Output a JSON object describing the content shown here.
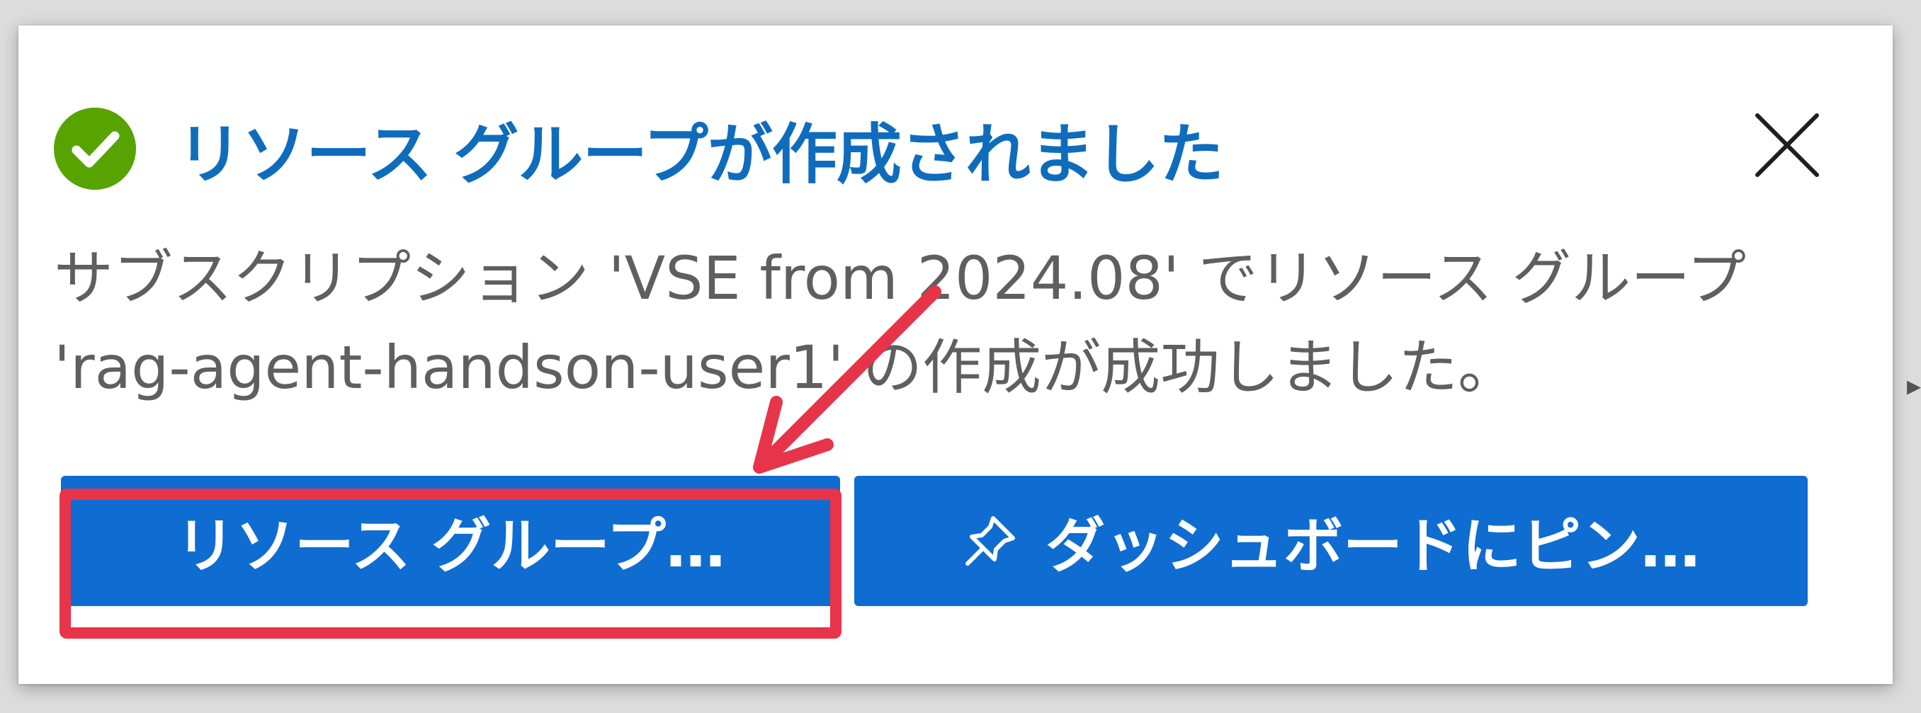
{
  "notification": {
    "status_icon": "check-circle-icon",
    "title": "リソース グループが作成されました",
    "message_line1": "サブスクリプション 'VSE from 2024.08' でリソース グループ",
    "message_line2": "'rag-agent-handson-user1' の作成が成功しました。",
    "close_icon": "close-icon"
  },
  "actions": {
    "resource_group_label": "リソース グループ…",
    "pin_label": "ダッシュボードにピン…",
    "pin_icon": "pin-icon"
  },
  "colors": {
    "success": "#57a300",
    "title": "#0f6cbd",
    "button": "#0f6cd1",
    "annotation": "#e8344a"
  }
}
